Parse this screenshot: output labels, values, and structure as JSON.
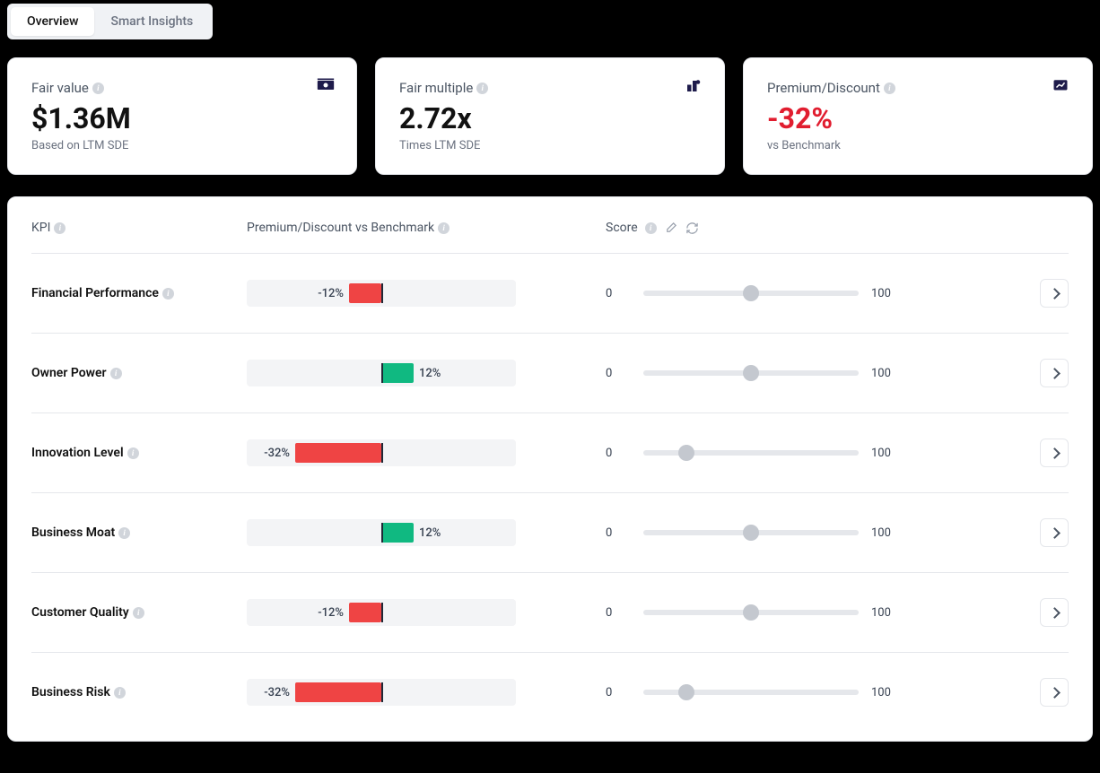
{
  "tabs": [
    "Overview",
    "Smart Insights"
  ],
  "active_tab": 0,
  "cards": [
    {
      "label": "Fair value",
      "value": "$1.36M",
      "sub": "Based on LTM SDE",
      "icon": "cash-icon",
      "neg": false
    },
    {
      "label": "Fair multiple",
      "value": "2.72x",
      "sub": "Times LTM SDE",
      "icon": "multiple-icon",
      "neg": false
    },
    {
      "label": "Premium/Discount",
      "value": "-32%",
      "sub": "vs Benchmark",
      "icon": "chart-icon",
      "neg": true
    }
  ],
  "headers": {
    "kpi": "KPI",
    "pd": "Premium/Discount vs Benchmark",
    "score": "Score"
  },
  "score_range": {
    "min": "0",
    "max": "100"
  },
  "rows": [
    {
      "name": "Financial Performance",
      "pd": -12,
      "pd_label": "-12%",
      "score": 50
    },
    {
      "name": "Owner Power",
      "pd": 12,
      "pd_label": "12%",
      "score": 50
    },
    {
      "name": "Innovation Level",
      "pd": -32,
      "pd_label": "-32%",
      "score": 20
    },
    {
      "name": "Business Moat",
      "pd": 12,
      "pd_label": "12%",
      "score": 50
    },
    {
      "name": "Customer Quality",
      "pd": -12,
      "pd_label": "-12%",
      "score": 50
    },
    {
      "name": "Business Risk",
      "pd": -32,
      "pd_label": "-32%",
      "score": 20
    }
  ],
  "colors": {
    "neg": "#ef4444",
    "pos": "#10b981",
    "discount_value": "#e11d2f"
  }
}
